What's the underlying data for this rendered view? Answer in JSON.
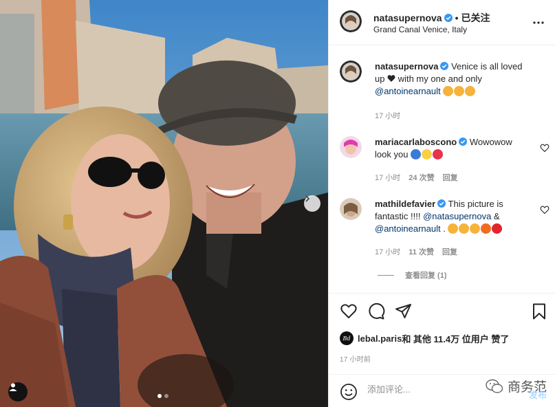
{
  "post": {
    "username": "natasupernova",
    "follow_separator": "•",
    "follow_label": "已关注",
    "location": "Grand Canal Venice, Italy",
    "carousel_index": 1,
    "carousel_total": 2
  },
  "caption": {
    "username": "natasupernova",
    "text_1": " Venice is all loved up ",
    "text_2": " with my one and only",
    "mention": "@antoinearnault",
    "time": "17 小时"
  },
  "comments": [
    {
      "username": "mariacarlaboscono",
      "text": " Wowowow look you ",
      "time": "17 小时",
      "likes": "24 次赞",
      "reply": "回复"
    },
    {
      "username": "mathildefavier",
      "text_1": " This picture is fantastic !!!! ",
      "mention_1": "@natasupernova",
      "text_2": " & ",
      "mention_2": "@antoinearnault",
      "text_3": " . ",
      "time": "17 小时",
      "likes": "11 次赞",
      "reply": "回复"
    }
  ],
  "view_replies": "查看回复 (1)",
  "likes_line": {
    "liker": "lebal.paris",
    "rest": " 和 其他 11.4万 位用户 赞了",
    "avatar_text": "Bd"
  },
  "posted_time": "17 小时前",
  "add_comment": {
    "placeholder": "添加评论...",
    "post_label": "发布"
  },
  "watermark": "商务范",
  "colors": {
    "accent": "#0095f6",
    "verified": "#3897f0",
    "mention": "#00376b",
    "muted": "#8e8e8e"
  },
  "icons": [
    "more-icon",
    "heart-icon",
    "comment-icon",
    "share-icon",
    "bookmark-icon",
    "emoji-icon",
    "verified-icon",
    "chevron-right-icon",
    "user-tag-icon"
  ]
}
